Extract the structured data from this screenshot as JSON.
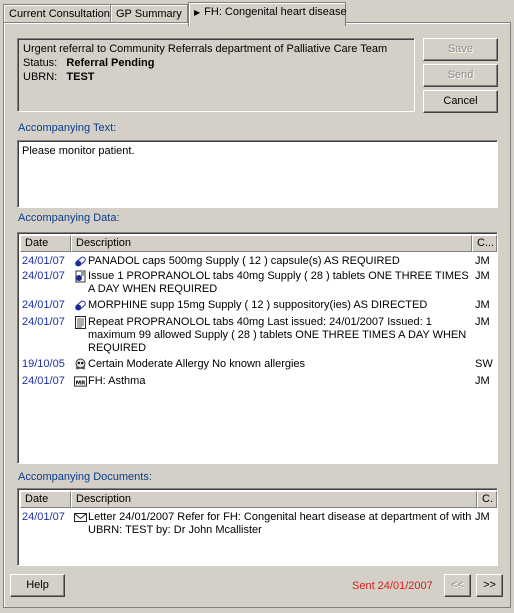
{
  "tabs": [
    {
      "label": "Current Consultation"
    },
    {
      "label": "GP Summary"
    },
    {
      "label": "FH: Congenital heart disease"
    }
  ],
  "info": {
    "line1": "Urgent referral to Community Referrals  department of Palliative Care Team",
    "status_label": "Status:",
    "status_value": "Referral Pending",
    "ubrn_label": "UBRN:",
    "ubrn_value": "TEST"
  },
  "buttons": {
    "save": "Save",
    "send": "Send",
    "cancel": "Cancel",
    "help": "Help",
    "prev": "<<",
    "next": ">>"
  },
  "accompanying_text": {
    "label": "Accompanying Text:",
    "value": "Please monitor patient."
  },
  "accompanying_data": {
    "label": "Accompanying Data:",
    "columns": [
      "Date",
      "Description",
      "C..."
    ],
    "rows": [
      {
        "date": "24/01/07",
        "icon": "capsule-icon",
        "desc": "PANADOL caps 500mg  Supply ( 12 ) capsule(s)   AS REQUIRED",
        "user": "JM"
      },
      {
        "date": "24/01/07",
        "icon": "prescription-issue-icon",
        "desc": "Issue 1 PROPRANOLOL tabs 40mg  Supply ( 28 ) tablets   ONE THREE TIMES A DAY WHEN REQUIRED",
        "user": "JM"
      },
      {
        "date": "24/01/07",
        "icon": "capsule-icon",
        "desc": "MORPHINE supp 15mg  Supply ( 12 ) suppository(ies)   AS DIRECTED",
        "user": "JM"
      },
      {
        "date": "24/01/07",
        "icon": "repeat-prescription-icon",
        "desc": "Repeat  PROPRANOLOL tabs 40mg  Last  issued: 24/01/2007  Issued: 1  maximum  99  allowed  Supply ( 28 ) tablets   ONE THREE TIMES A DAY WHEN REQUIRED",
        "user": "JM"
      },
      {
        "date": "19/10/05",
        "icon": "allergy-skull-icon",
        "desc": "Certain Moderate Allergy No known allergies",
        "user": "SW"
      },
      {
        "date": "24/01/07",
        "icon": "family-history-icon",
        "desc": "FH: Asthma",
        "user": "JM"
      }
    ]
  },
  "accompanying_documents": {
    "label": "Accompanying Documents:",
    "columns": [
      "Date",
      "Description",
      "C."
    ],
    "rows": [
      {
        "date": "24/01/07",
        "icon": "letter-icon",
        "desc": "Letter 24/01/2007 Refer for   FH: Congenital heart disease  at   department of  with  UBRN: TEST by:  Dr John Mcallister",
        "user": "JM"
      }
    ]
  },
  "status_footer": "Sent 24/01/2007"
}
